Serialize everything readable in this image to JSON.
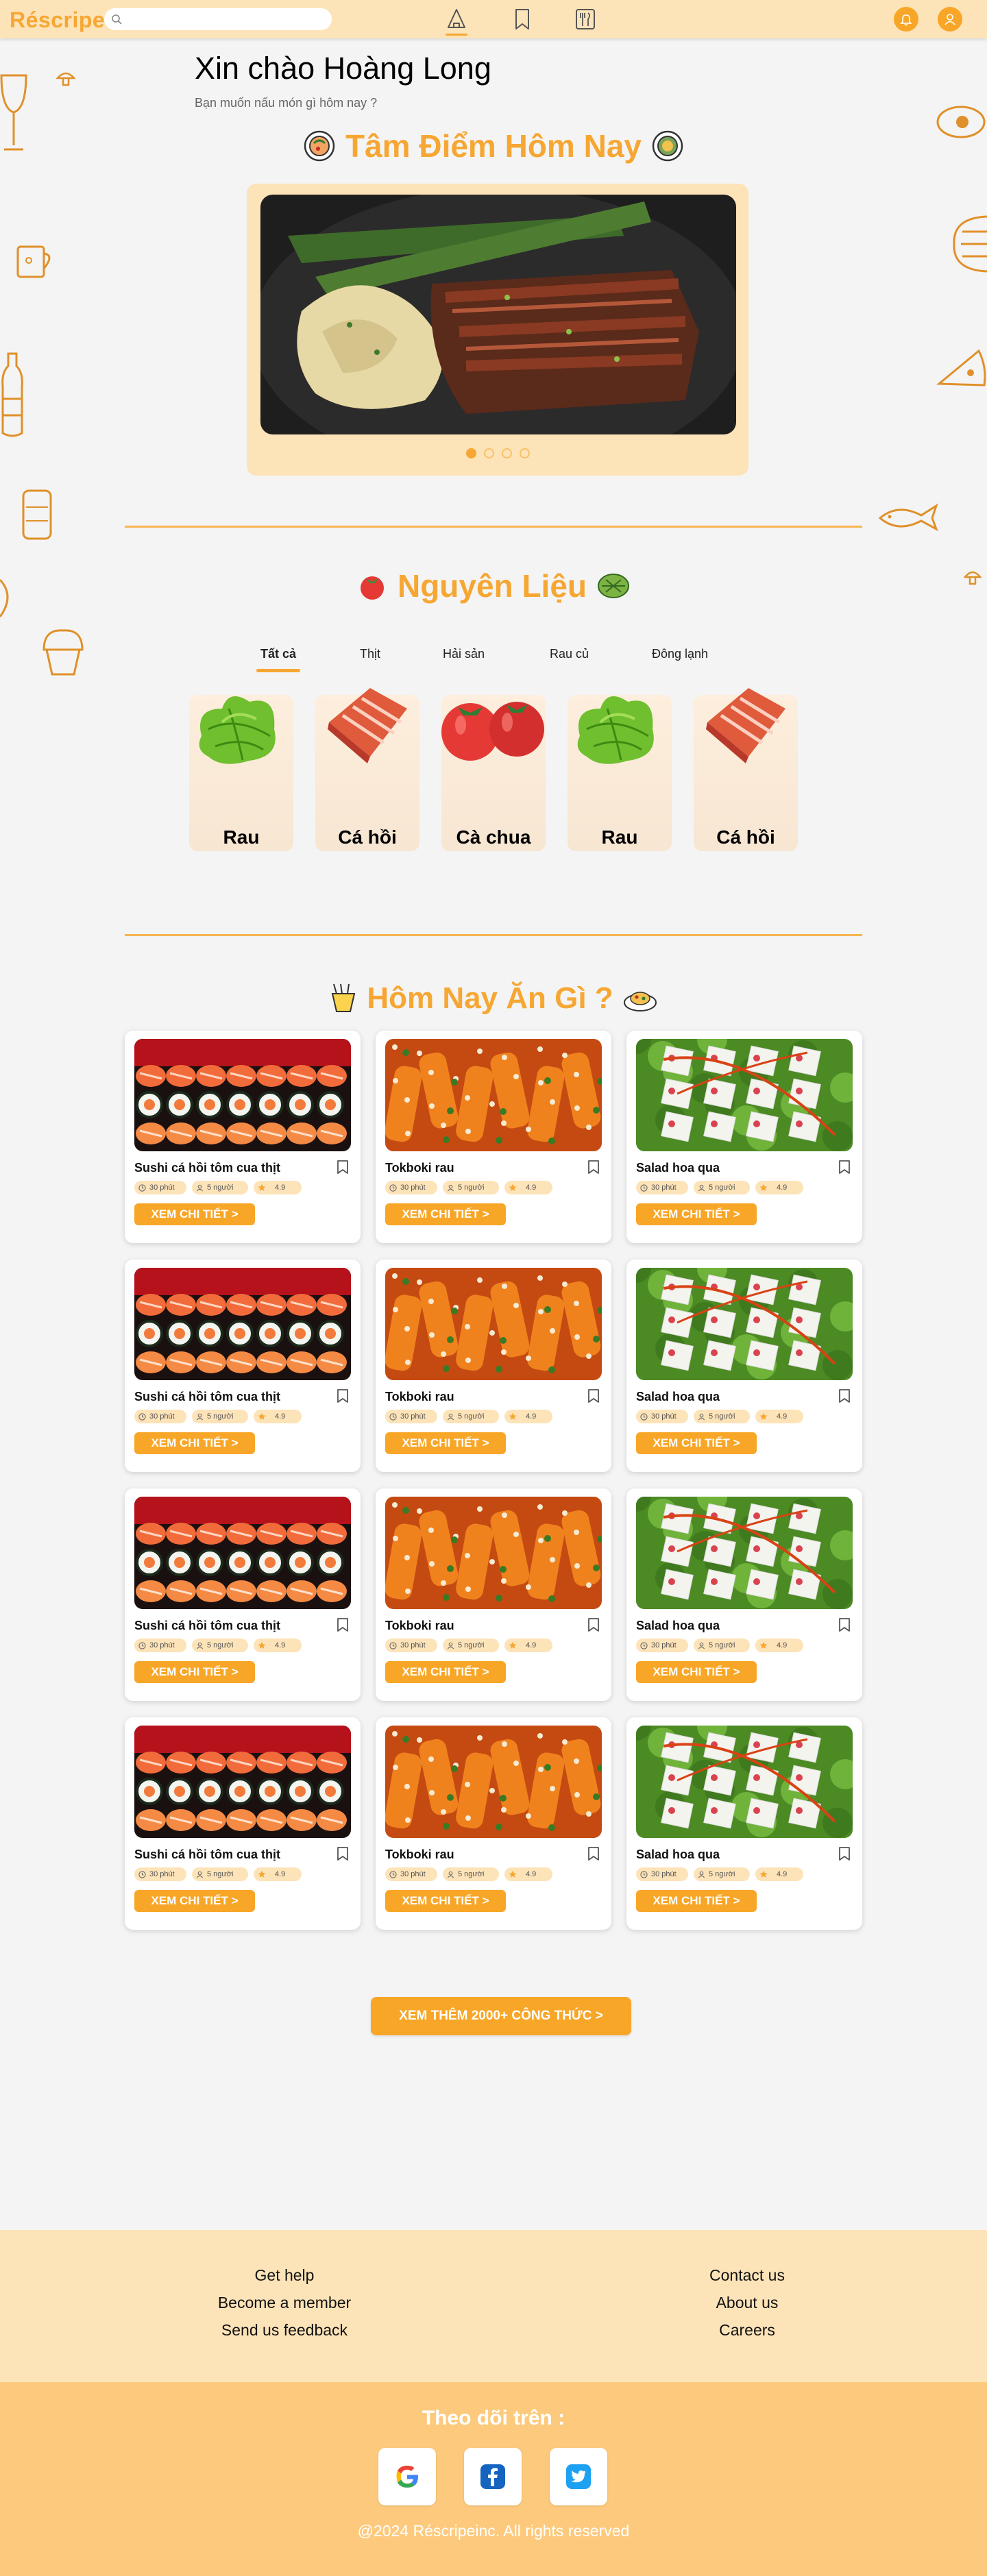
{
  "header": {
    "logo": "Réscripe",
    "search_placeholder": "",
    "nav": [
      "home-icon",
      "bookmark-icon",
      "recipe-book-icon"
    ],
    "actions": [
      "notification-icon",
      "user-icon"
    ]
  },
  "greeting": {
    "title": "Xin chào Hoàng Long",
    "subtitle": "Bạn muốn nấu món gì hôm nay ?"
  },
  "featured": {
    "title": "Tâm Điểm Hôm Nay",
    "slide_count": 4,
    "active_slide": 1
  },
  "ingredients": {
    "title": "Nguyên Liệu",
    "tabs": [
      "Tất cả",
      "Thịt",
      "Hải sản",
      "Rau củ",
      "Đông lạnh"
    ],
    "active_tab": 0,
    "items": [
      "Rau",
      "Cá hồi",
      "Cà chua",
      "Rau",
      "Cá hồi"
    ]
  },
  "recipes": {
    "title": "Hôm Nay Ăn Gì ?",
    "time": "30 phút",
    "servings": "5 người",
    "rating": "4.9",
    "detail_label": "XEM CHI TIẾT >",
    "names": [
      "Sushi cá hồi tôm cua thịt",
      "Tokboki rau",
      "Salad hoa qua"
    ],
    "rows": 4
  },
  "more_button": "XEM THÊM 2000+ CÔNG THỨC >",
  "footer": {
    "left_links": [
      "Get help",
      "Become a member",
      "Send us feedback"
    ],
    "right_links": [
      "Contact us",
      "About us",
      "Careers"
    ],
    "follow": "Theo dõi trên :",
    "socials": [
      "google-icon",
      "facebook-icon",
      "twitter-icon"
    ],
    "copyright": "@2024 Réscripeinc. All rights reserved"
  },
  "colors": {
    "accent": "#f6a733",
    "header_bg": "#fde3b8",
    "footer_bg": "#fdca7d"
  }
}
